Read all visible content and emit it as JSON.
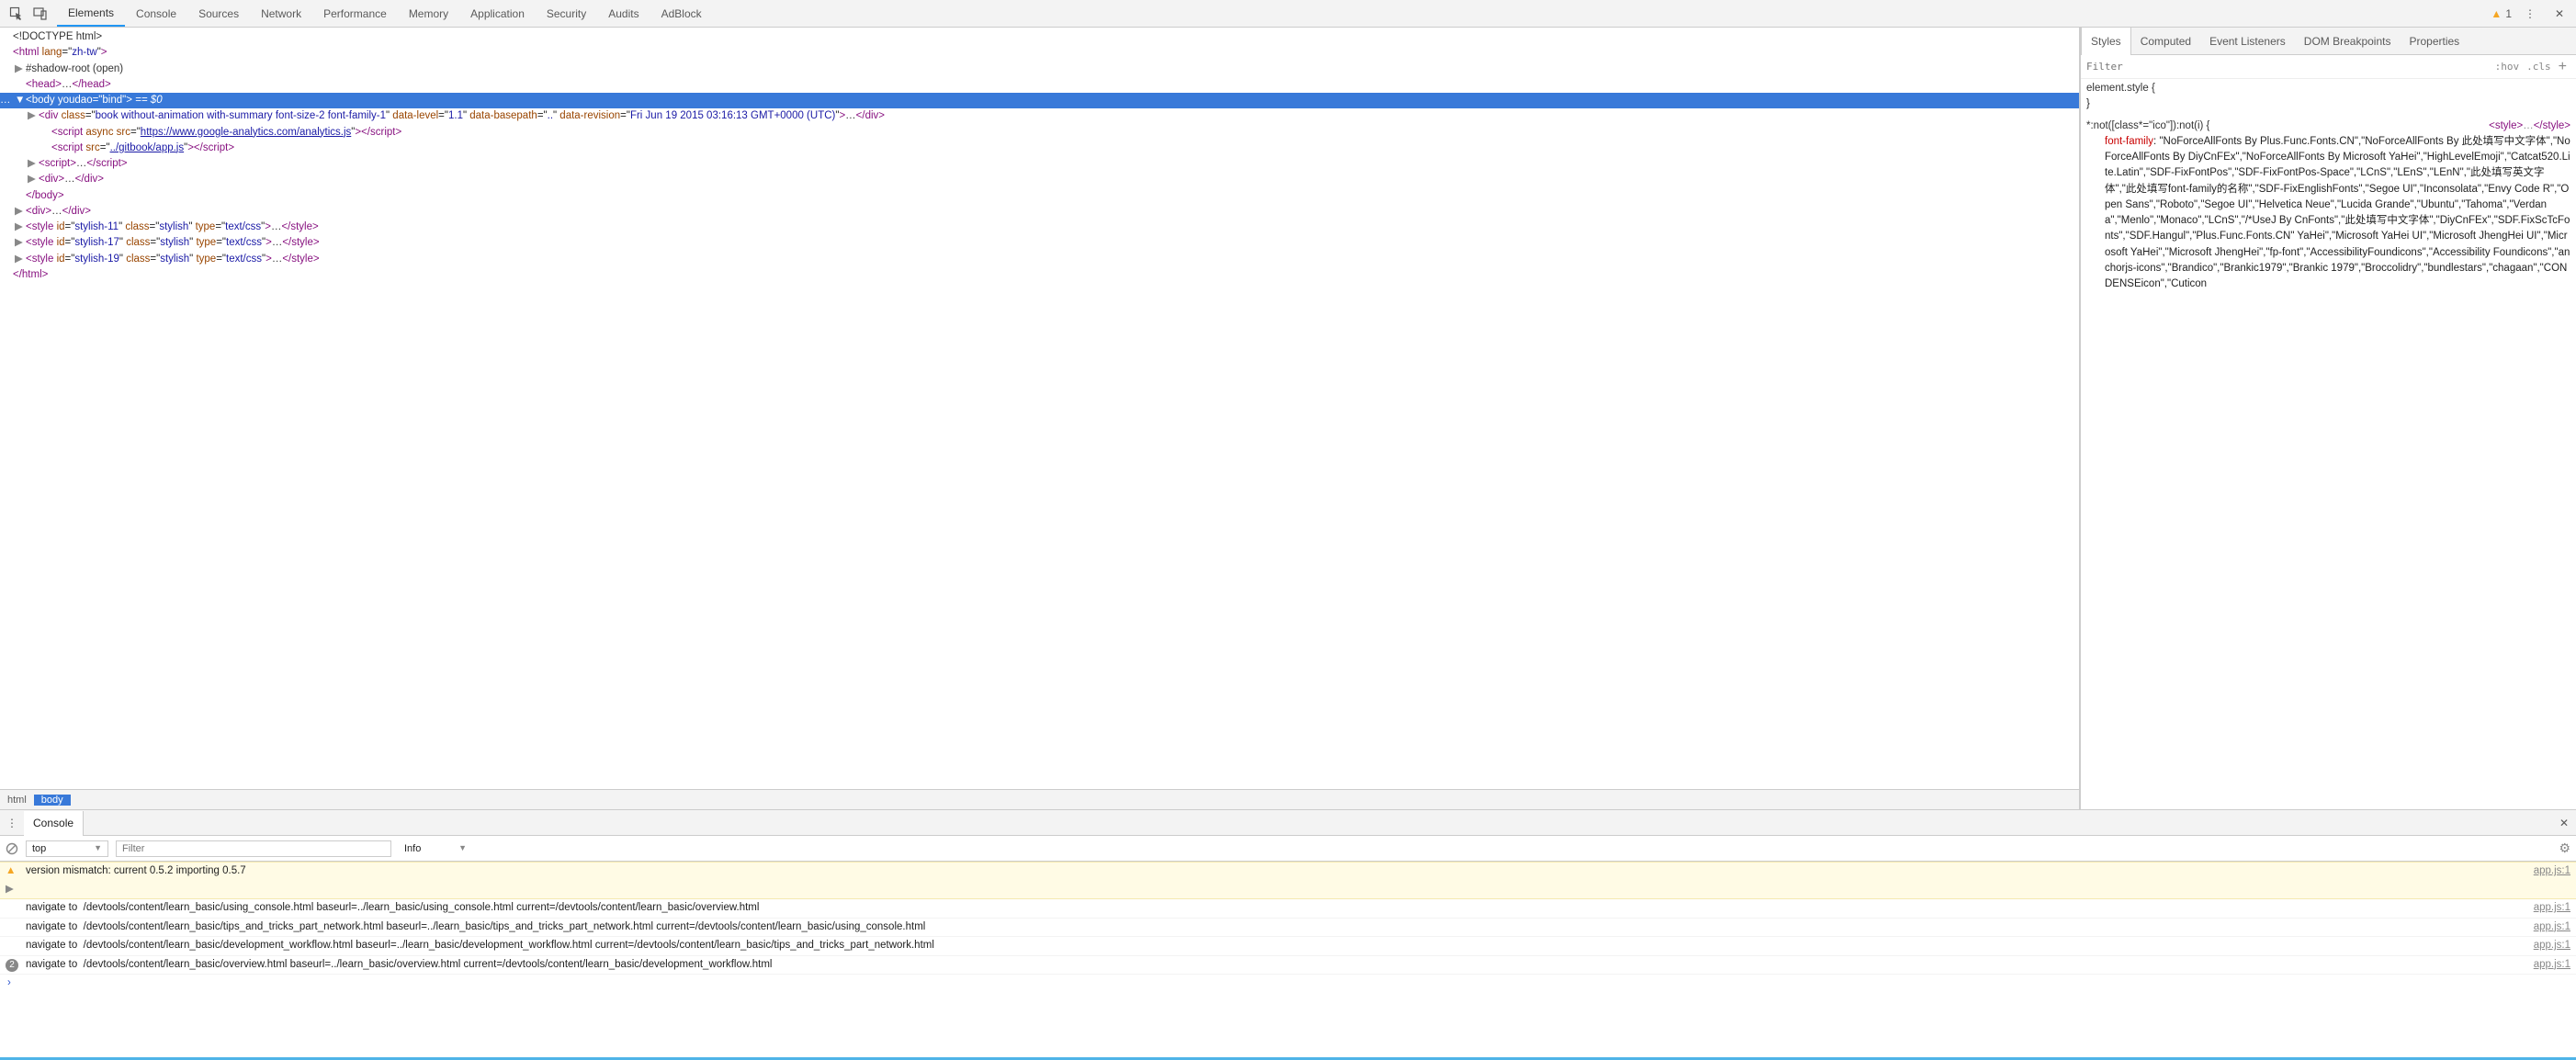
{
  "toolbar": {
    "tabs": [
      "Elements",
      "Console",
      "Sources",
      "Network",
      "Performance",
      "Memory",
      "Application",
      "Security",
      "Audits",
      "AdBlock"
    ],
    "activeTab": "Elements",
    "warnCount": "1"
  },
  "dom": {
    "lines": [
      {
        "indent": 0,
        "html": "<span class='txt'>&lt;!DOCTYPE html&gt;</span>"
      },
      {
        "indent": 0,
        "html": "<span class='tag'>&lt;html</span> <span class='attr'>lang</span>=\"<span class='val'>zh-tw</span>\"<span class='tag'>&gt;</span>"
      },
      {
        "indent": 1,
        "exp": "▶",
        "html": "<span class='txt'>#shadow-root (open)</span>"
      },
      {
        "indent": 1,
        "html": "<span class='tag'>&lt;head&gt;</span><span class='txt'>…</span><span class='tag'>&lt;/head&gt;</span>"
      },
      {
        "indent": 1,
        "exp": "▼",
        "sel": true,
        "html": "<span class='tag'>&lt;body</span> <span class='attr'>youdao</span>=\"<span class='val'>bind</span>\"<span class='tag'>&gt;</span> <span class='eqdollar'>== $0</span>",
        "prefix": "…"
      },
      {
        "indent": 2,
        "exp": "▶",
        "html": "<span class='tag'>&lt;div</span> <span class='attr'>class</span>=\"<span class='val'>book without-animation with-summary font-size-2 font-family-1</span>\" <span class='attr'>data-level</span>=\"<span class='val'>1.1</span>\" <span class='attr'>data-basepath</span>=\"<span class='val'>..</span>\" <span class='attr'>data-revision</span>=\"<span class='val'>Fri Jun 19 2015 03:16:13 GMT+0000 (UTC)</span>\"<span class='tag'>&gt;</span><span class='txt'>…</span><span class='tag'>&lt;/div&gt;</span>"
      },
      {
        "indent": 3,
        "html": "<span class='tag'>&lt;script</span> <span class='attr'>async src</span>=\"<span class='urll'>https://www.google-analytics.com/analytics.js</span>\"<span class='tag'>&gt;&lt;/script&gt;</span>"
      },
      {
        "indent": 3,
        "html": "<span class='tag'>&lt;script</span> <span class='attr'>src</span>=\"<span class='urll'>../gitbook/app.js</span>\"<span class='tag'>&gt;&lt;/script&gt;</span>"
      },
      {
        "indent": 2,
        "exp": "▶",
        "html": "<span class='tag'>&lt;script&gt;</span><span class='txt'>…</span><span class='tag'>&lt;/script&gt;</span>"
      },
      {
        "indent": 2,
        "exp": "▶",
        "html": "<span class='tag'>&lt;div&gt;</span><span class='txt'>…</span><span class='tag'>&lt;/div&gt;</span>"
      },
      {
        "indent": 1,
        "html": "<span class='tag'>&lt;/body&gt;</span>"
      },
      {
        "indent": 1,
        "exp": "▶",
        "html": "<span class='tag'>&lt;div&gt;</span><span class='txt'>…</span><span class='tag'>&lt;/div&gt;</span>"
      },
      {
        "indent": 1,
        "exp": "▶",
        "html": "<span class='tag'>&lt;style</span> <span class='attr'>id</span>=\"<span class='val'>stylish-11</span>\" <span class='attr'>class</span>=\"<span class='val'>stylish</span>\" <span class='attr'>type</span>=\"<span class='val'>text/css</span>\"<span class='tag'>&gt;</span><span class='txt'>…</span><span class='tag'>&lt;/style&gt;</span>"
      },
      {
        "indent": 1,
        "exp": "▶",
        "html": "<span class='tag'>&lt;style</span> <span class='attr'>id</span>=\"<span class='val'>stylish-17</span>\" <span class='attr'>class</span>=\"<span class='val'>stylish</span>\" <span class='attr'>type</span>=\"<span class='val'>text/css</span>\"<span class='tag'>&gt;</span><span class='txt'>…</span><span class='tag'>&lt;/style&gt;</span>"
      },
      {
        "indent": 1,
        "exp": "▶",
        "html": "<span class='tag'>&lt;style</span> <span class='attr'>id</span>=\"<span class='val'>stylish-19</span>\" <span class='attr'>class</span>=\"<span class='val'>stylish</span>\" <span class='attr'>type</span>=\"<span class='val'>text/css</span>\"<span class='tag'>&gt;</span><span class='txt'>…</span><span class='tag'>&lt;/style&gt;</span>"
      },
      {
        "indent": 0,
        "html": "<span class='tag'>&lt;/html&gt;</span>"
      }
    ],
    "crumbs": [
      "html",
      "body"
    ],
    "activeCrumb": "body"
  },
  "sidebar": {
    "tabs": [
      "Styles",
      "Computed",
      "Event Listeners",
      "DOM Breakpoints",
      "Properties"
    ],
    "activeTab": "Styles",
    "filterPlaceholder": "Filter",
    "hov": ":hov",
    "cls": ".cls",
    "elementStyle": "element.style {",
    "closeBrace": "}",
    "selector": "*:not([class*=\"ico\"]):not(i) {",
    "srcLink": "<style>…</style>",
    "prop": "font-family",
    "propVal": "\"NoForceAllFonts By Plus.Func.Fonts.CN\",\"NoForceAllFonts By 此处填写中文字体\",\"NoForceAllFonts By DiyCnFEx\",\"NoForceAllFonts By Microsoft YaHei\",\"HighLevelEmoji\",\"Catcat520.Lite.Latin\",\"SDF-FixFontPos\",\"SDF-FixFontPos-Space\",\"LCnS\",\"LEnS\",\"LEnN\",\"此处填写英文字体\",\"此处填写font-family的名称\",\"SDF-FixEnglishFonts\",\"Segoe UI\",\"Inconsolata\",\"Envy Code R\",\"Open Sans\",\"Roboto\",\"Segoe UI\",\"Helvetica Neue\",\"Lucida Grande\",\"Ubuntu\",\"Tahoma\",\"Verdana\",\"Menlo\",\"Monaco\",\"LCnS\",\"/*UseJ By CnFonts\",\"此处填写中文字体\",\"DiyCnFEx\",\"SDF.FixScTcFonts\",\"SDF.Hangul\",\"Plus.Func.Fonts.CN\" YaHei\",\"Microsoft YaHei UI\",\"Microsoft JhengHei UI\",\"Microsoft YaHei\",\"Microsoft JhengHei\",\"fp-font\",\"AccessibilityFoundicons\",\"Accessibility Foundicons\",\"anchorjs-icons\",\"Brandico\",\"Brankic1979\",\"Brankic 1979\",\"Broccolidry\",\"bundlestars\",\"chagaan\",\"CONDENSEicon\",\"Cuticon"
  },
  "drawer": {
    "title": "Console",
    "context": "top",
    "filterPlaceholder": "Filter",
    "level": "Info",
    "rows": [
      {
        "type": "warn",
        "msg": "version mismatch: current 0.5.2 importing 0.5.7",
        "src": "app.js:1"
      },
      {
        "type": "log",
        "msg": "navigate to  /devtools/content/learn_basic/using_console.html baseurl=../learn_basic/using_console.html current=/devtools/content/learn_basic/overview.html",
        "src": "app.js:1"
      },
      {
        "type": "log",
        "msg": "navigate to  /devtools/content/learn_basic/tips_and_tricks_part_network.html baseurl=../learn_basic/tips_and_tricks_part_network.html current=/devtools/content/learn_basic/using_console.html",
        "src": "app.js:1"
      },
      {
        "type": "log",
        "msg": "navigate to  /devtools/content/learn_basic/development_workflow.html baseurl=../learn_basic/development_workflow.html current=/devtools/content/learn_basic/tips_and_tricks_part_network.html",
        "src": "app.js:1"
      },
      {
        "type": "log",
        "badge": "2",
        "msg": "navigate to  /devtools/content/learn_basic/overview.html baseurl=../learn_basic/overview.html current=/devtools/content/learn_basic/development_workflow.html",
        "src": "app.js:1"
      }
    ]
  }
}
